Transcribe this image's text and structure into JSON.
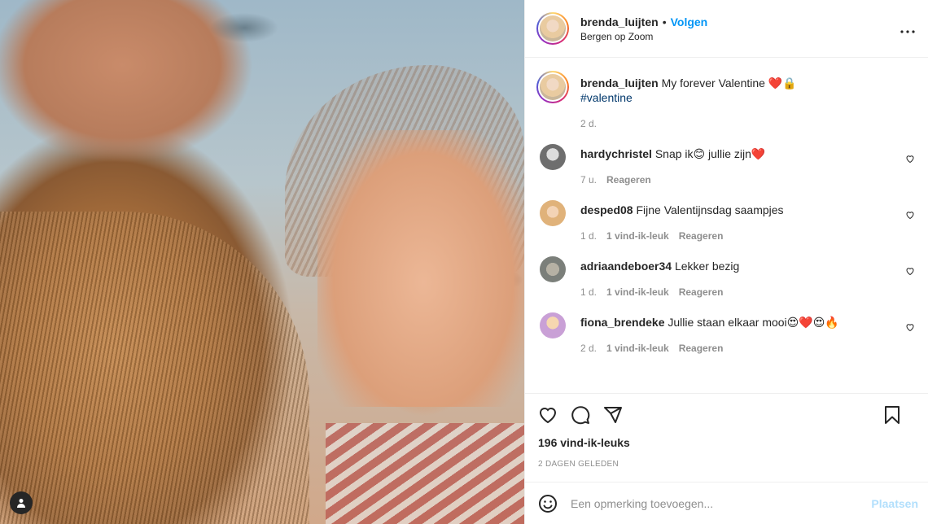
{
  "header": {
    "username": "brenda_luijten",
    "dot": "•",
    "follow_label": "Volgen",
    "location": "Bergen op Zoom",
    "more_icon": "more-horizontal-icon"
  },
  "caption": {
    "username": "brenda_luijten",
    "text": "My forever Valentine ❤️🔒",
    "hashtag": "#valentine",
    "time": "2 d."
  },
  "comments": [
    {
      "username": "hardychristel",
      "text": "Snap ik😊 jullie zijn❤️",
      "time": "7 u.",
      "likes": "",
      "reply": "Reageren",
      "avatar_color": "#8a8a8a"
    },
    {
      "username": "desped08",
      "text": "Fijne Valentijnsdag saampjes",
      "time": "1 d.",
      "likes": "1 vind-ik-leuk",
      "reply": "Reageren",
      "avatar_color": "#e0b27a"
    },
    {
      "username": "adriaandeboer34",
      "text": "Lekker bezig",
      "time": "1 d.",
      "likes": "1 vind-ik-leuk",
      "reply": "Reageren",
      "avatar_color": "#8b8f8a"
    },
    {
      "username": "fiona_brendeke",
      "text": "Jullie staan elkaar mooi😍❤️😍🔥",
      "time": "2 d.",
      "likes": "1 vind-ik-leuk",
      "reply": "Reageren",
      "avatar_color": "#c9a0d6"
    }
  ],
  "actions": {
    "likes_count": "196 vind-ik-leuks",
    "posted_ago": "2 DAGEN GELEDEN"
  },
  "add_comment": {
    "placeholder": "Een opmerking toevoegen...",
    "post_label": "Plaatsen"
  }
}
